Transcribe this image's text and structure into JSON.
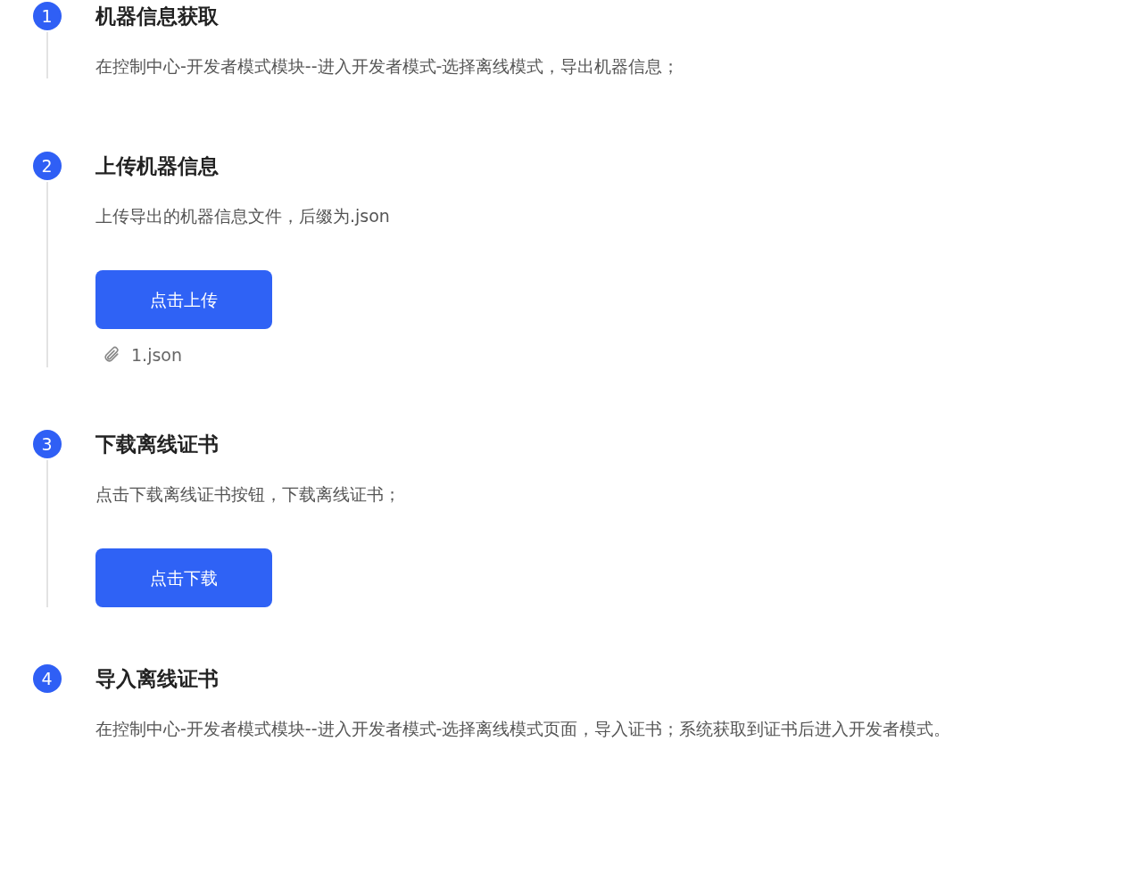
{
  "steps": [
    {
      "number": "1",
      "title": "机器信息获取",
      "description": "在控制中心-开发者模式模块--进入开发者模式-选择离线模式，导出机器信息；"
    },
    {
      "number": "2",
      "title": "上传机器信息",
      "description": "上传导出的机器信息文件，后缀为.json",
      "button": "点击上传",
      "file": "1.json"
    },
    {
      "number": "3",
      "title": "下载离线证书",
      "description": "点击下载离线证书按钮，下载离线证书；",
      "button": "点击下载"
    },
    {
      "number": "4",
      "title": "导入离线证书",
      "description": "在控制中心-开发者模式模块--进入开发者模式-选择离线模式页面，导入证书；系统获取到证书后进入开发者模式。"
    }
  ]
}
